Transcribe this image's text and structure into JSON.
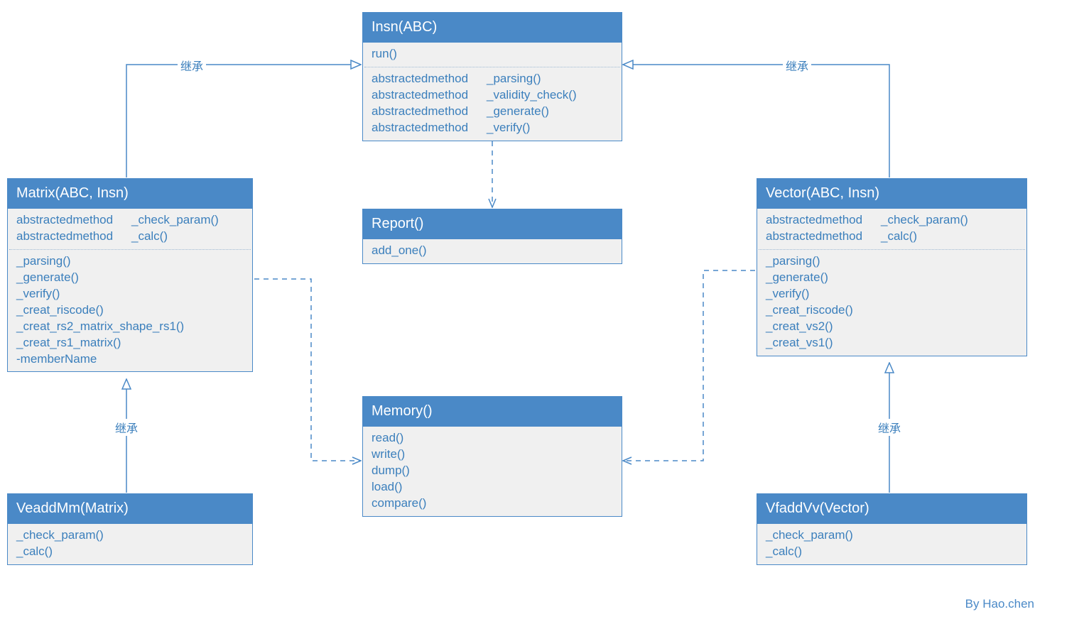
{
  "labels": {
    "inherit": "继承",
    "credit": "By Hao.chen"
  },
  "insn": {
    "title": "Insn(ABC)",
    "section1": [
      "run()"
    ],
    "section2": [
      {
        "kw": "abstractedmethod",
        "name": "_parsing()"
      },
      {
        "kw": "abstractedmethod",
        "name": "_validity_check()"
      },
      {
        "kw": "abstractedmethod",
        "name": "_generate()"
      },
      {
        "kw": "abstractedmethod",
        "name": "_verify()"
      }
    ]
  },
  "matrix": {
    "title": "Matrix(ABC, Insn)",
    "section1": [
      {
        "kw": "abstractedmethod",
        "name": "_check_param()"
      },
      {
        "kw": "abstractedmethod",
        "name": "_calc()"
      }
    ],
    "section2": [
      "_parsing()",
      "_generate()",
      "_verify()",
      "_creat_riscode()",
      "_creat_rs2_matrix_shape_rs1()",
      "_creat_rs1_matrix()",
      "-memberName"
    ]
  },
  "vector": {
    "title": "Vector(ABC, Insn)",
    "section1": [
      {
        "kw": "abstractedmethod",
        "name": "_check_param()"
      },
      {
        "kw": "abstractedmethod",
        "name": "_calc()"
      }
    ],
    "section2": [
      "_parsing()",
      "_generate()",
      "_verify()",
      "_creat_riscode()",
      "_creat_vs2()",
      "_creat_vs1()"
    ]
  },
  "report": {
    "title": "Report()",
    "section1": [
      "add_one()"
    ]
  },
  "memory": {
    "title": "Memory()",
    "section1": [
      "read()",
      "write()",
      "dump()",
      "load()",
      "compare()"
    ]
  },
  "veaddmm": {
    "title": "VeaddMm(Matrix)",
    "section1": [
      "_check_param()",
      "_calc()"
    ]
  },
  "vfaddvv": {
    "title": "VfaddVv(Vector)",
    "section1": [
      "_check_param()",
      "_calc()"
    ]
  }
}
